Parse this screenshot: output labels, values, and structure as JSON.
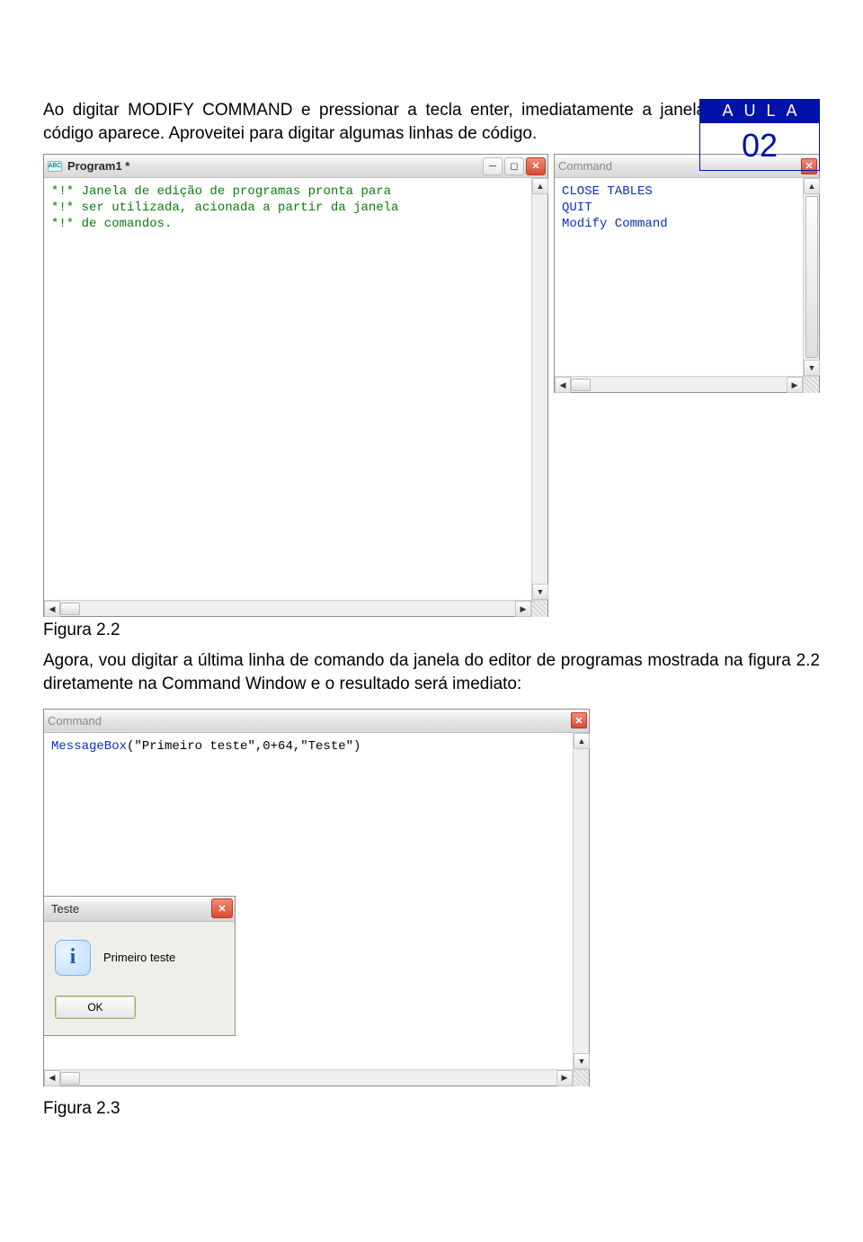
{
  "badge": {
    "top": "AULA",
    "num": "02"
  },
  "p1": "Ao digitar MODIFY COMMAND e pressionar a tecla enter, imediatamente a janela de edição de código aparece. Aproveitei para digitar algumas linhas de código.",
  "fig22": {
    "editor": {
      "icon_label": "ABC",
      "title": "Program1 *",
      "lines": [
        "*!* Janela de edição de programas pronta para",
        "*!* ser utilizada, acionada a partir da janela",
        "*!* de comandos."
      ]
    },
    "command": {
      "title": "Command",
      "lines": [
        "CLOSE TABLES",
        "QUIT",
        "Modify Command"
      ]
    }
  },
  "caption22": "Figura 2.2",
  "p2": "Agora, vou digitar a última linha de comando da janela do editor de programas mostrada na figura 2.2 diretamente na Command Window e o resultado será imediato:",
  "fig23": {
    "command": {
      "title": "Command",
      "line_fn": "MessageBox",
      "line_args": "(\"Primeiro teste\",0+64,\"Teste\")"
    },
    "msgbox": {
      "title": "Teste",
      "text": "Primeiro teste",
      "ok": "OK"
    }
  },
  "caption23": "Figura 2.3"
}
